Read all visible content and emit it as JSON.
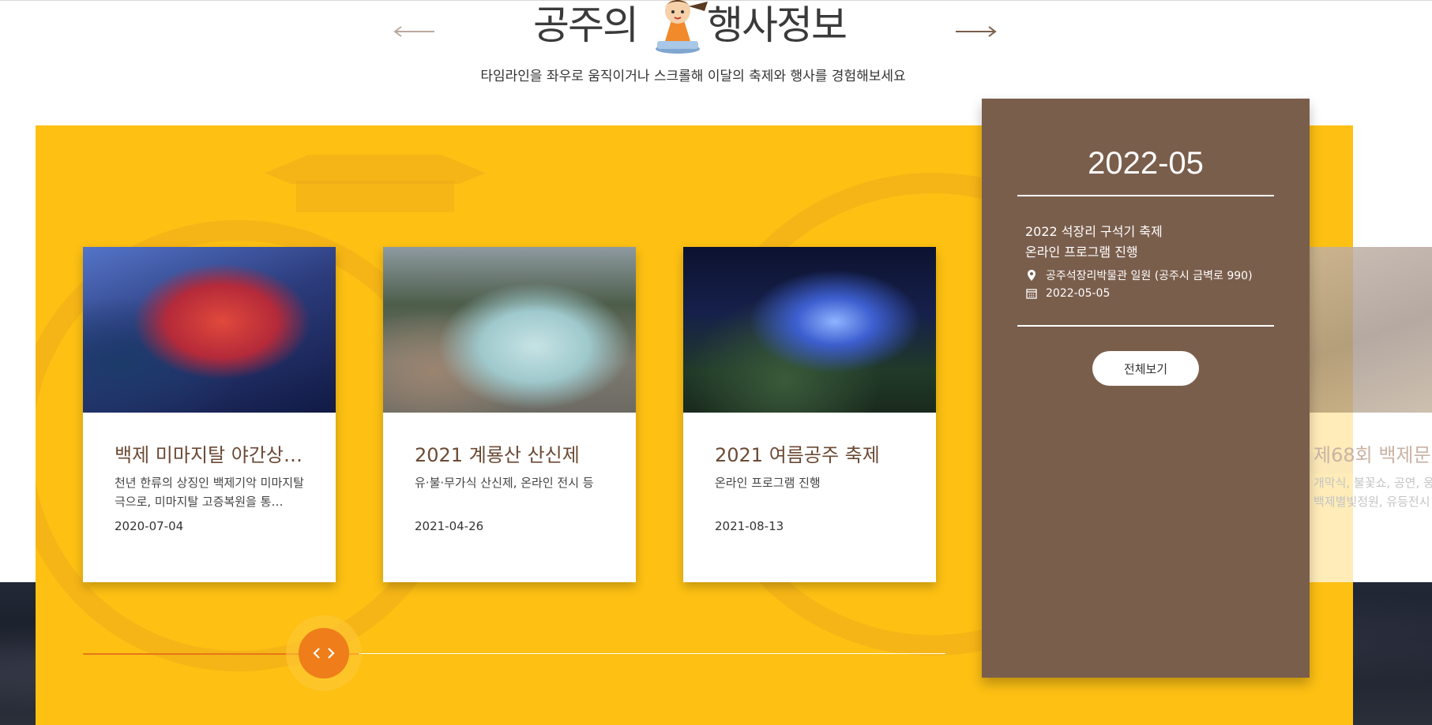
{
  "section": {
    "title_part1": "공주의",
    "title_part2": "행사정보",
    "subtitle": "타임라인을 좌우로 움직이거나 스크롤해 이달의 축제와 행사를 경험해보세요"
  },
  "nav": {
    "prev_icon": "arrow-left-icon",
    "next_icon": "arrow-right-icon"
  },
  "events": [
    {
      "title": "백제 미마지탈 야간상설공연",
      "desc": "천년 한류의 상징인 백제기악 미마지탈극으로, 미마지탈 고증복원을 통…",
      "date": "2020-07-04"
    },
    {
      "title": "2021 계룡산 산신제",
      "desc": "유·불·무가식 산신제, 온라인 전시 등",
      "date": "2021-04-26"
    },
    {
      "title": "2021 여름공주 축제",
      "desc": "온라인 프로그램 진행",
      "date": "2021-08-13"
    }
  ],
  "featured": {
    "month": "2022-05",
    "title_line1": "2022 석장리 구석기 축제",
    "title_line2": "온라인 프로그램 진행",
    "location": "공주석장리박물관 일원 (공주시 금벽로 990)",
    "date": "2022-05-05",
    "button_label": "전체보기"
  },
  "next_event": {
    "title": "제68회 백제문",
    "desc_line1": "개막식, 불꽃쇼, 공연, 웅",
    "desc_line2": "백제별빛정원, 유등전시"
  },
  "timeline": {
    "progress": 0.32
  },
  "colors": {
    "yellow": "#fdc013",
    "brown_panel": "#7a5e4c",
    "card_title": "#6b4a35",
    "handle": "#ef7d1a"
  }
}
